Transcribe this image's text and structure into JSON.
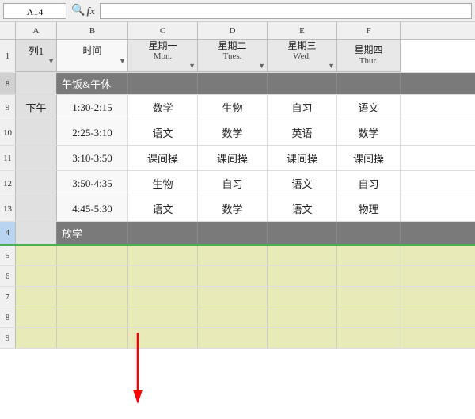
{
  "toolbar": {
    "cell_ref": "A14",
    "fx_label": "fx"
  },
  "col_headers": {
    "row_num": "",
    "cols": [
      "A",
      "B",
      "C",
      "D",
      "E",
      "F"
    ]
  },
  "header_row": {
    "col_a": "列1",
    "col_b": "时间",
    "col_c_line1": "星期一",
    "col_c_line2": "Mon.",
    "col_d_line1": "星期二",
    "col_d_line2": "Tues.",
    "col_e_line1": "星期三",
    "col_e_line2": "Wed.",
    "col_f_line1": "星期四",
    "col_f_line2": "Thur."
  },
  "rows": [
    {
      "row_num": "8",
      "col_a": "",
      "col_b": "午饭&午休",
      "col_c": "",
      "col_d": "",
      "col_e": "",
      "col_f": "",
      "type": "section"
    },
    {
      "row_num": "9",
      "col_a": "下午",
      "col_b": "1:30-2:15",
      "col_c": "数学",
      "col_d": "生物",
      "col_e": "自习",
      "col_f": "语文",
      "type": "data"
    },
    {
      "row_num": "10",
      "col_a": "",
      "col_b": "2:25-3:10",
      "col_c": "语文",
      "col_d": "数学",
      "col_e": "英语",
      "col_f": "数学",
      "type": "data"
    },
    {
      "row_num": "11",
      "col_a": "",
      "col_b": "3:10-3:50",
      "col_c": "课间操",
      "col_d": "课间操",
      "col_e": "课间操",
      "col_f": "课间操",
      "type": "data"
    },
    {
      "row_num": "12",
      "col_a": "",
      "col_b": "3:50-4:35",
      "col_c": "生物",
      "col_d": "自习",
      "col_e": "语文",
      "col_f": "自习",
      "type": "data"
    },
    {
      "row_num": "13",
      "col_a": "",
      "col_b": "4:45-5:30",
      "col_c": "语文",
      "col_d": "数学",
      "col_e": "语文",
      "col_f": "物理",
      "type": "data"
    },
    {
      "row_num": "4",
      "col_a": "",
      "col_b": "放学",
      "col_c": "",
      "col_d": "",
      "col_e": "",
      "col_f": "",
      "type": "dismissal"
    }
  ],
  "empty_rows": [
    "5",
    "6",
    "7",
    "8",
    "9"
  ],
  "row_nums_display": [
    "5",
    "6",
    "7",
    "8",
    "9"
  ]
}
